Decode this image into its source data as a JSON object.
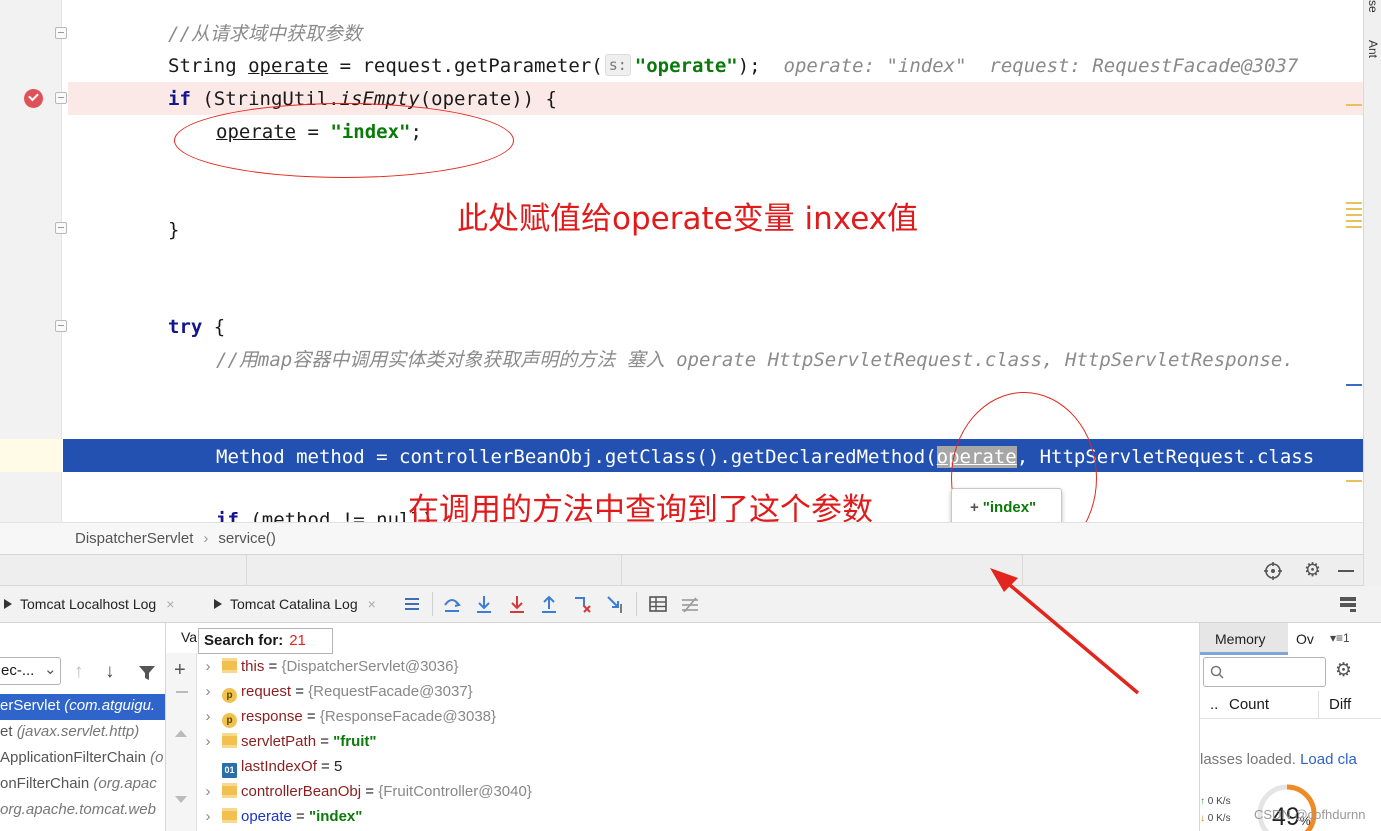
{
  "editor": {
    "comment1": "//从请求域中获取参数",
    "line2": {
      "p1": "String ",
      "var": "operate",
      "p2": " = request.getParameter(",
      "hint": "s:",
      "str": "\"operate\"",
      "p3": ");",
      "dbg1": "operate: \"index\"",
      "dbg2": "request: RequestFacade@3037"
    },
    "line3": {
      "kw": "if",
      "p1": " (StringUtil.",
      "method": "isEmpty",
      "p2": "(operate)) {"
    },
    "line4": {
      "var": "operate",
      "p1": " = ",
      "str": "\"index\"",
      "p2": ";"
    },
    "brace_close": "}",
    "line_try": {
      "kw": "try",
      "p1": " {"
    },
    "comment2": "//用map容器中调用实体类对象获取声明的方法 塞入 operate HttpServletRequest.class, HttpServletResponse.",
    "exec_line": {
      "p1": "Method method = controllerBeanObj.getClass().getDeclaredMethod(",
      "sel": "operate",
      "p2": ", HttpServletRequest.class"
    },
    "partial_line": {
      "kw": "if",
      "p1": " (method != null)"
    },
    "popup_value": "\"index\"",
    "popup_plus": "+"
  },
  "annotations": {
    "top": "此处赋值给operate变量 inxex值",
    "bottom": "在调用的方法中查询到了这个参数"
  },
  "right_rail": {
    "top": "se",
    "ant": "Ant"
  },
  "breadcrumb": {
    "cls": "DispatcherServlet",
    "sep": "›",
    "method": "service()"
  },
  "tabs": {
    "tab1": "Tomcat Localhost Log",
    "tab2": "Tomcat Catalina Log",
    "close": "×"
  },
  "frames": {
    "selector": "ec-...",
    "items": [
      {
        "main": "erServlet ",
        "pkg": "(com.atguigu."
      },
      {
        "main": "et ",
        "pkg": "(javax.servlet.http)"
      },
      {
        "main": "ApplicationFilterChain ",
        "pkg": "(o"
      },
      {
        "main": "onFilterChain ",
        "pkg": "(org.apac"
      },
      {
        "main": "",
        "pkg": "org.apache.tomcat.web"
      }
    ],
    "more": "»"
  },
  "variables": {
    "header": "Va",
    "search_label": "Search for:",
    "search_count": "21",
    "rows": [
      {
        "name": "this",
        "eq": " = ",
        "value": "{DispatcherServlet@3036}"
      },
      {
        "name": "request",
        "eq": " = ",
        "value": "{RequestFacade@3037}"
      },
      {
        "name": "response",
        "eq": " = ",
        "value": "{ResponseFacade@3038}"
      },
      {
        "name": "servletPath",
        "eq": " = ",
        "value": "\"fruit\""
      },
      {
        "name": "lastIndexOf",
        "eq": " = ",
        "value": "5"
      },
      {
        "name": "controllerBeanObj",
        "eq": " = ",
        "value": "{FruitController@3040}"
      },
      {
        "name": "operate",
        "eq": " = ",
        "value": "\"index\""
      }
    ],
    "icon_prim": "01",
    "icon_param": "p"
  },
  "memory": {
    "tab1": "Memory",
    "tab2": "Ov",
    "col_dots": "..",
    "col_count": "Count",
    "col_diff": "Diff",
    "status": "lasses loaded.",
    "load": "Load cla",
    "net_up": "0  K/s",
    "net_down": "0  K/s",
    "percent": "49",
    "percent_sign": "%",
    "watermark": "CSDN @cofhdurnn"
  }
}
